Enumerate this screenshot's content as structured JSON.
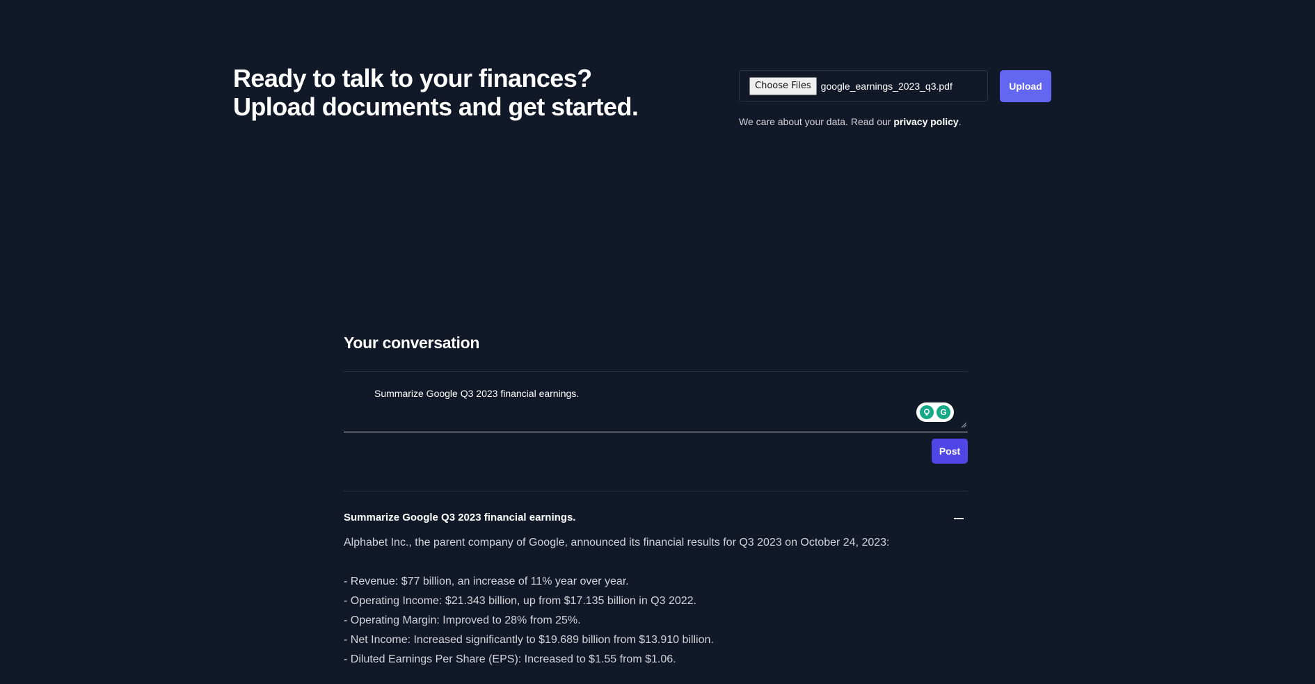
{
  "hero": {
    "line1": "Ready to talk to your finances?",
    "line2": "Upload documents and get started."
  },
  "upload": {
    "choose_files_label": "Choose Files",
    "file_name": "google_earnings_2023_q3.pdf",
    "upload_label": "Upload",
    "privacy_text": "We care about your data. Read our ",
    "privacy_link": "privacy policy",
    "privacy_end": "."
  },
  "conversation": {
    "title": "Your conversation",
    "composer_text": "Summarize Google Q3 2023 financial earnings.",
    "post_label": "Post",
    "grammarly_g": "G",
    "question": "Summarize Google Q3 2023 financial earnings.",
    "answer_intro": "Alphabet Inc., the parent company of Google, announced its financial results for Q3 2023 on October 24, 2023:",
    "answer_items": [
      "- Revenue: $77 billion, an increase of 11% year over year.",
      "- Operating Income: $21.343 billion, up from $17.135 billion in Q3 2022.",
      "- Operating Margin: Improved to 28% from 25%.",
      "- Net Income: Increased significantly to $19.689 billion from $13.910 billion.",
      "- Diluted Earnings Per Share (EPS): Increased to $1.55 from $1.06."
    ]
  },
  "colors": {
    "background": "#111827",
    "upload_button": "#6366f1",
    "post_button": "#4f46e5",
    "grammarly": "#15a988"
  }
}
